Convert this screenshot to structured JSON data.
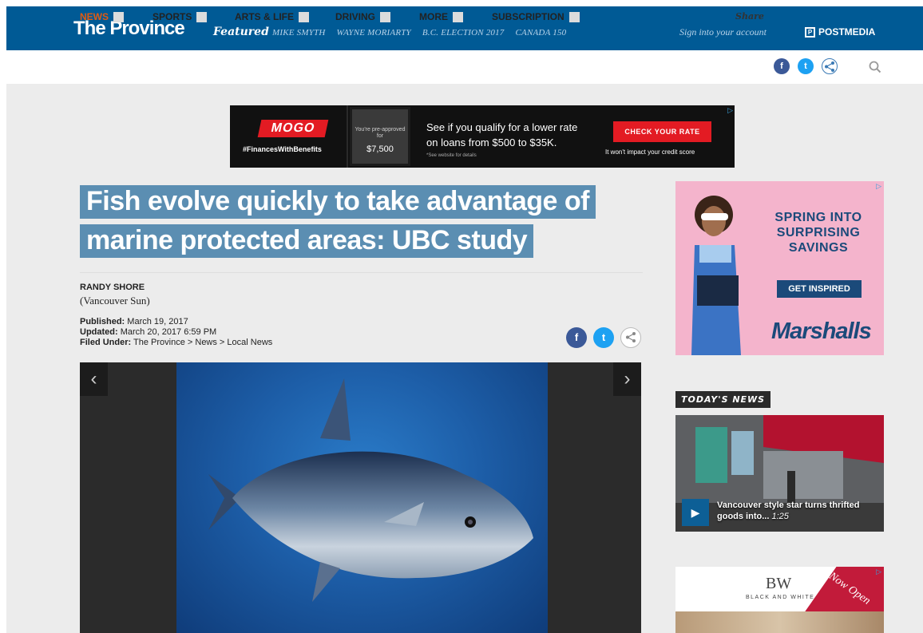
{
  "header": {
    "logo": "The Province",
    "featured_label": "Featured",
    "featured_links": [
      "MIKE SMYTH",
      "WAYNE MORIARTY",
      "B.C. ELECTION 2017",
      "CANADA 150"
    ],
    "signin": "Sign into your account",
    "postmedia": "POSTMEDIA",
    "postmedia_mark": "P"
  },
  "nav": {
    "items": [
      "NEWS",
      "SPORTS",
      "ARTS & LIFE",
      "DRIVING",
      "MORE",
      "SUBSCRIPTION"
    ],
    "share_label": "Share",
    "active_item": "NEWS",
    "accent_color": "#e05a12"
  },
  "top_ad": {
    "brand": "MOGO",
    "tagline": "#FinancesWithBenefits",
    "phone_text": "You're pre-approved for",
    "phone_amount": "$7,500",
    "headline_line1": "See if you qualify for a lower rate",
    "headline_line2": "on loans from $500 to $35K.",
    "fine_print": "*See website for details",
    "button": "CHECK YOUR RATE",
    "note": "It won't impact your credit score"
  },
  "article": {
    "headline_line1": "Fish evolve quickly to take advantage of",
    "headline_line2": "marine protected areas: UBC study",
    "author": "RANDY SHORE",
    "source": "(Vancouver Sun)",
    "published_label": "Published:",
    "published": "March 19, 2017",
    "updated_label": "Updated:",
    "updated": "March 20, 2017 6:59 PM",
    "filed_label": "Filed Under:",
    "filed": "The Province > News > Local News"
  },
  "sidebar": {
    "ad1": {
      "headline": "SPRING INTO SURPRISING SAVINGS",
      "button": "GET INSPIRED",
      "brand": "Marshalls"
    },
    "todays_news_label": "TODAY'S NEWS",
    "news_card": {
      "title": "Vancouver style star turns thrifted goods into...",
      "duration": "1:25"
    },
    "ad2": {
      "logo": "BW",
      "name": "BLACK AND WHITE",
      "banner": "Now Open"
    }
  },
  "icons": {
    "facebook": "f",
    "twitter": "t",
    "share": "share-icon",
    "search": "search-icon",
    "prev": "‹",
    "next": "›",
    "play": "▶"
  },
  "colors": {
    "brand_blue": "#005a95",
    "headline_bg": "#5b8eb2",
    "facebook": "#3b5998",
    "twitter": "#1da1f2",
    "cta_red": "#e31b23"
  }
}
